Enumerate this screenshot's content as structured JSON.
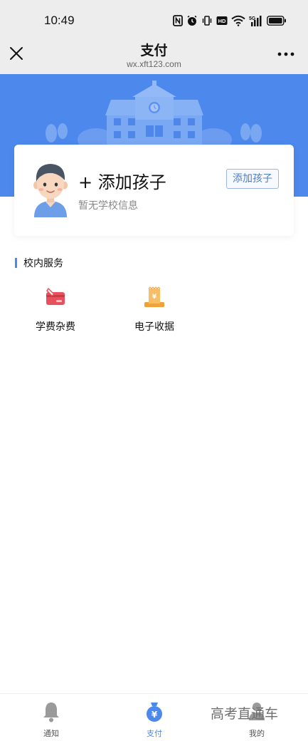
{
  "status_bar": {
    "time": "10:49",
    "icons": [
      "nfc-icon",
      "alarm-icon",
      "vibrate-icon",
      "hd-icon",
      "wifi-icon",
      "signal-5g-icon",
      "battery-icon"
    ]
  },
  "nav": {
    "title": "支付",
    "url": "wx.xft123.com",
    "close_icon": "close-icon",
    "more_icon": "more-icon"
  },
  "banner": {
    "background_color": "#4d88ed",
    "illustration": "school-building-illustration"
  },
  "child_card": {
    "title": "+ 添加孩子",
    "subtitle": "暂无学校信息",
    "button_label": "添加孩子",
    "avatar_icon": "boy-avatar-icon"
  },
  "services": {
    "section_title": "校内服务",
    "items": [
      {
        "label": "学费杂费",
        "icon": "tuition-card-icon",
        "color": "#e8515b"
      },
      {
        "label": "电子收据",
        "icon": "receipt-icon",
        "color": "#f0a23a"
      }
    ]
  },
  "tab_bar": {
    "accent_color": "#4d88ed",
    "tabs": [
      {
        "label": "通知",
        "icon": "bell-icon",
        "active": false
      },
      {
        "label": "支付",
        "icon": "money-bag-icon",
        "active": true
      },
      {
        "label": "我的",
        "icon": "user-icon",
        "active": false
      }
    ]
  },
  "watermark": "高考直通车"
}
